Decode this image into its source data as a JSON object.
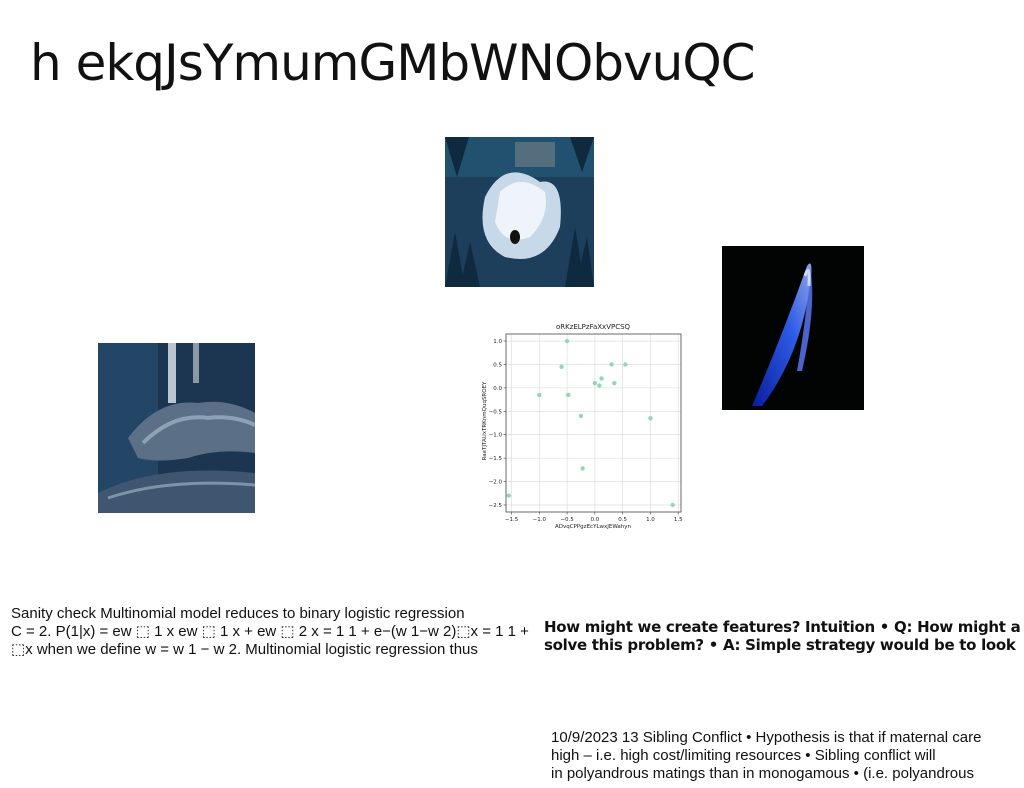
{
  "slide": {
    "title": "h ekqJsYmumGMbWNObvuQC"
  },
  "text_blocks": {
    "left": [
      "Sanity check Multinomial model reduces to binary logistic regression",
      "C = 2. P(1|x) = ew ⬚ 1 x ew ⬚ 1 x + ew ⬚ 2 x = 1 1 + e−(w 1−w 2)⬚x = 1 1 +",
      "⬚x when we define w = w 1 − w 2. Multinomial logistic regression thus"
    ],
    "bold": [
      "How might we create features? Intuition • Q: How might a",
      "solve this problem? • A: Simple strategy would be to look"
    ],
    "bottom_right": [
      "10/9/2023 13 Sibling Conflict • Hypothesis is that if maternal care",
      "high – i.e. high cost/limiting resources • Sibling conflict will",
      "in polyandrous matings than in monogamous • (i.e. polyandrous"
    ]
  },
  "colors": {
    "point": "#8fd9b3",
    "grid": "#d9d9d9",
    "glow": "#2f5bff"
  },
  "icons": {
    "photo_lake": "lake-reflection-photo",
    "photo_log": "driftwood-log-photo",
    "photo_glow": "blue-light-streak-photo"
  },
  "chart_data": {
    "type": "scatter",
    "title": "oRKzELPzFaXxVPCSQ",
    "xlabel": "ADvqCPPgzEcYLwxJEWahyn",
    "ylabel": "RaeTJTAUxTRKnmQuqSROEY",
    "xlim": [
      -1.6,
      1.55
    ],
    "ylim": [
      -2.65,
      1.15
    ],
    "xticks": [
      -1.5,
      -1.0,
      -0.5,
      0.0,
      0.5,
      1.0,
      1.5
    ],
    "xtick_labels": [
      "−1.5",
      "−1.0",
      "−0.5",
      "0.0",
      "0.5",
      "1.0",
      "1.5"
    ],
    "yticks": [
      1.0,
      0.5,
      0.0,
      -0.5,
      -1.0,
      -1.5,
      -2.0,
      -2.5
    ],
    "ytick_labels": [
      "1.0",
      "0.5",
      "0.0",
      "−0.5",
      "−1.0",
      "−1.5",
      "−2.0",
      "−2.5"
    ],
    "grid": true,
    "points": [
      {
        "x": -1.55,
        "y": -2.3
      },
      {
        "x": -1.0,
        "y": -0.15
      },
      {
        "x": -0.6,
        "y": 0.45
      },
      {
        "x": -0.5,
        "y": 1.0
      },
      {
        "x": -0.48,
        "y": -0.15
      },
      {
        "x": -0.25,
        "y": -0.6
      },
      {
        "x": -0.22,
        "y": -1.72
      },
      {
        "x": 0.0,
        "y": 0.1
      },
      {
        "x": 0.08,
        "y": 0.05
      },
      {
        "x": 0.12,
        "y": 0.2
      },
      {
        "x": 0.3,
        "y": 0.5
      },
      {
        "x": 0.35,
        "y": 0.1
      },
      {
        "x": 0.55,
        "y": 0.5
      },
      {
        "x": 1.0,
        "y": -0.65
      },
      {
        "x": 1.4,
        "y": -2.5
      }
    ]
  }
}
